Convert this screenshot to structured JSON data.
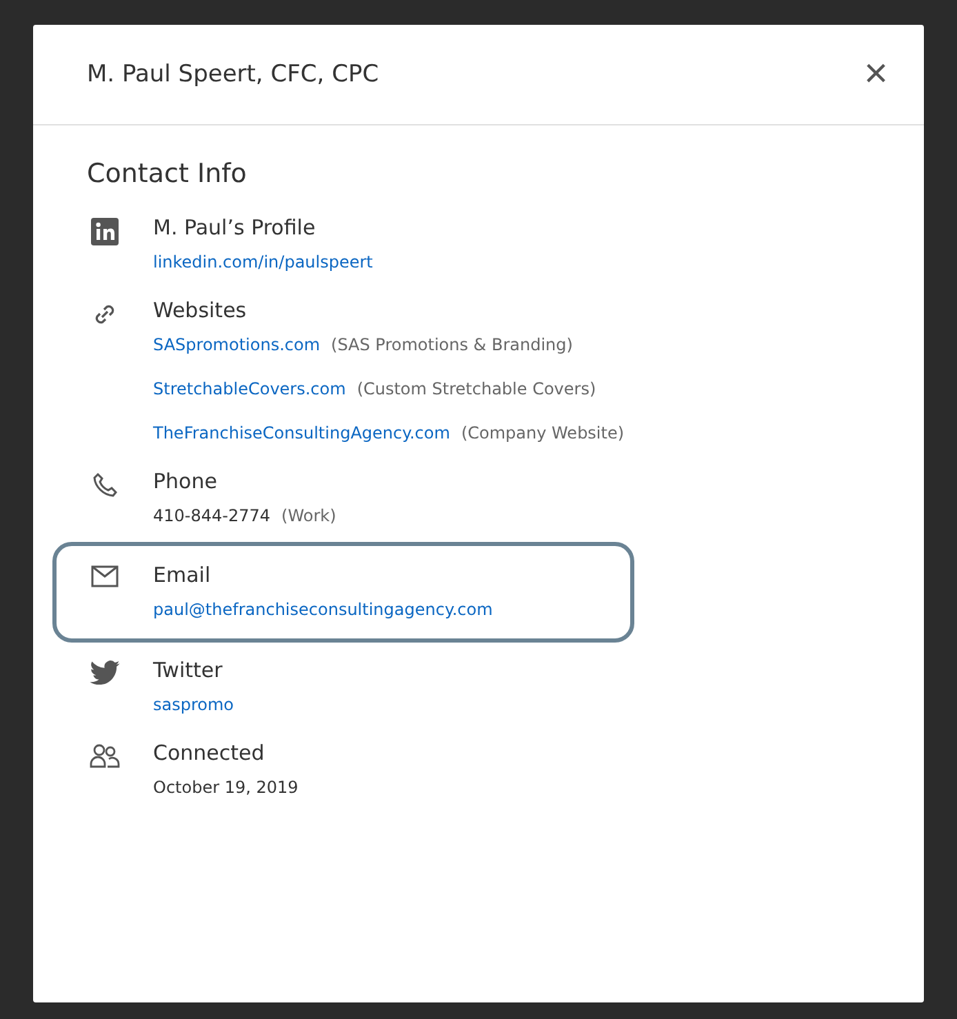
{
  "dialog": {
    "title": "M. Paul Speert, CFC, CPC",
    "close": "×"
  },
  "section_title": "Contact Info",
  "entries": [
    {
      "kind": "linkedin",
      "label": "M. Paul’s Profile",
      "highlighted": false,
      "lines": [
        {
          "link": "linkedin.com/in/paulspeert"
        }
      ]
    },
    {
      "kind": "link",
      "label": "Websites",
      "highlighted": false,
      "lines": [
        {
          "link": "SASpromotions.com",
          "note": "(SAS Promotions & Branding)"
        },
        {
          "link": "StretchableCovers.com",
          "note": "(Custom Stretchable Covers)"
        },
        {
          "link": "TheFranchiseConsultingAgency.com",
          "note": "(Company Website)"
        }
      ]
    },
    {
      "kind": "phone",
      "label": "Phone",
      "highlighted": false,
      "lines": [
        {
          "text": "410-844-2774",
          "note": "(Work)"
        }
      ]
    },
    {
      "kind": "email",
      "label": "Email",
      "highlighted": true,
      "lines": [
        {
          "link": "paul@thefranchiseconsultingagency.com"
        }
      ]
    },
    {
      "kind": "twitter",
      "label": "Twitter",
      "highlighted": false,
      "lines": [
        {
          "link": "saspromo"
        }
      ]
    },
    {
      "kind": "people",
      "label": "Connected",
      "highlighted": false,
      "lines": [
        {
          "text": "October 19, 2019"
        }
      ]
    }
  ]
}
